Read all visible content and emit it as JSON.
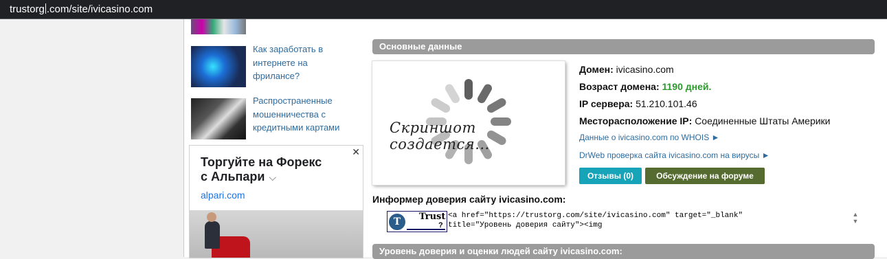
{
  "address_bar": {
    "url_before_caret": "trustorg",
    "url_after_caret": ".com/site/ivicasino.com"
  },
  "sidebar": {
    "articles": [
      {
        "title_line1": "Как заработать в",
        "title_line2": "интернете на",
        "title_line3": "фрилансе?"
      },
      {
        "title_line1": "Распространенные",
        "title_line2": "мошенничества с",
        "title_line3": "кредитными картами"
      }
    ],
    "ad": {
      "close": "✕",
      "title_line1": "Торгуйте на Форекс",
      "title_line2": "с Альпари",
      "chevron": "⌵",
      "url": "alpari.com"
    }
  },
  "main": {
    "section_title": "Основные данные",
    "screenshot_caption": "Скриншот создается...",
    "domain_label": "Домен:",
    "domain_value": "ivicasino.com",
    "age_label": "Возраст домена:",
    "age_value": "1190 дней.",
    "ip_label": "IP сервера:",
    "ip_value": "51.210.101.46",
    "location_label": "Месторасположение IP:",
    "location_value": "Соединенные Штаты Америки",
    "whois_link": "Данные о ivicasino.com по WHOIS ►",
    "drweb_link": "DrWeb проверка сайта ivicasino.com на вирусы ►",
    "reviews_button": "Отзывы (0)",
    "forum_button": "Обсуждение на форуме",
    "informer_title": "Информер доверия сайту ivicasino.com:",
    "trust_logo_word": "Trust",
    "trust_logo_q": "?",
    "trust_logo_letter": "T",
    "code_line1": "<a href=\"https://trustorg.com/site/ivicasino.com\" target=\"_blank\"",
    "code_line2": "title=\"Уровень доверия сайту\"><img",
    "trust_section_title": "Уровень доверия и оценки людей сайту ivicasino.com:"
  },
  "colors": {
    "green_value": "#2b9a2b",
    "link": "#2e6b9e",
    "reviews_btn": "#17a3b8",
    "forum_btn": "#556b2f",
    "section_bar": "#9b9b9b"
  }
}
